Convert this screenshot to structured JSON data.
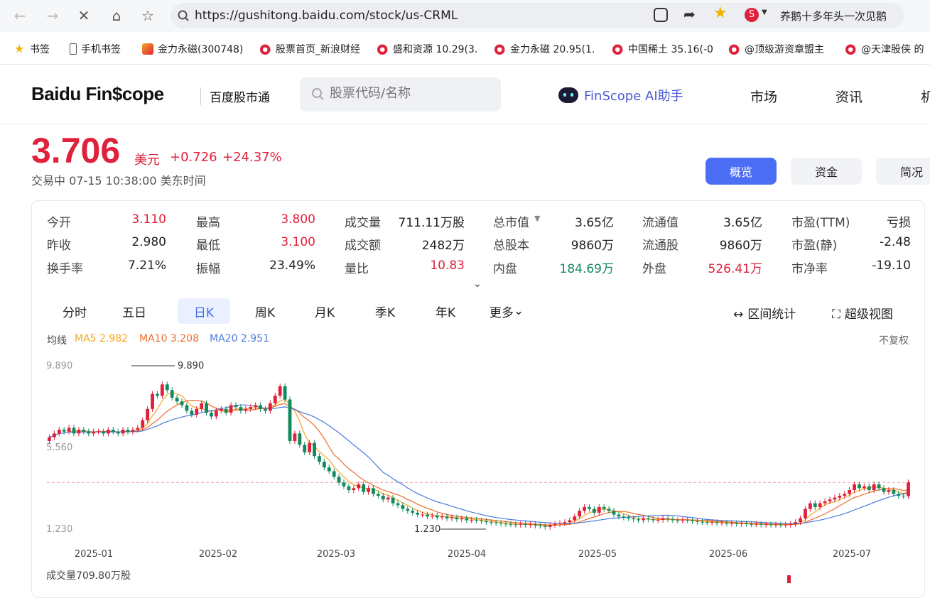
{
  "browser": {
    "url": "https://gushitong.baidu.com/stock/us-CRML",
    "tab_title": "养鹅十多年头一次见鹅"
  },
  "bookmarks": [
    {
      "label": "书签",
      "icon": "star-icon"
    },
    {
      "label": "手机书签",
      "icon": "phone-icon"
    },
    {
      "label": "金力永磁(300748)",
      "icon": "fund-icon"
    },
    {
      "label": "股票首页_新浪财经",
      "icon": "weibo-icon"
    },
    {
      "label": "盛和资源 10.29(3.",
      "icon": "weibo-icon"
    },
    {
      "label": "金力永磁 20.95(1.",
      "icon": "weibo-icon"
    },
    {
      "label": "中国稀土 35.16(-0",
      "icon": "weibo-icon"
    },
    {
      "label": "@顶级游资章盟主",
      "icon": "weibo-icon"
    },
    {
      "label": "@天津股侠 的",
      "icon": "weibo-icon"
    }
  ],
  "site": {
    "logo": "Baidu Fin$cope",
    "logo_sub": "百度股市通",
    "search_placeholder": "股票代码/名称",
    "ai_label": "FinScope AI助手",
    "nav": [
      "市场",
      "资讯",
      "机"
    ]
  },
  "quote": {
    "price": "3.706",
    "unit": "美元",
    "change": "+0.726",
    "change_pct": "+24.37%",
    "status": "交易中  07-15 10:38:00  美东时间"
  },
  "tabs": [
    "概览",
    "资金",
    "简况"
  ],
  "stats": [
    [
      {
        "label": "今开",
        "value": "3.110",
        "color": "red"
      },
      {
        "label": "最高",
        "value": "3.800",
        "color": "red"
      },
      {
        "label": "成交量",
        "value": "711.11万股",
        "color": ""
      },
      {
        "label": "总市值",
        "value": "3.65亿",
        "color": ""
      },
      {
        "label": "流通值",
        "value": "3.65亿",
        "color": ""
      },
      {
        "label": "市盈(TTM)",
        "value": "亏损",
        "color": ""
      }
    ],
    [
      {
        "label": "昨收",
        "value": "2.980",
        "color": ""
      },
      {
        "label": "最低",
        "value": "3.100",
        "color": "red"
      },
      {
        "label": "成交额",
        "value": "2482万",
        "color": ""
      },
      {
        "label": "总股本",
        "value": "9860万",
        "color": ""
      },
      {
        "label": "流通股",
        "value": "9860万",
        "color": ""
      },
      {
        "label": "市盈(静)",
        "value": "-2.48",
        "color": ""
      }
    ],
    [
      {
        "label": "换手率",
        "value": "7.21%",
        "color": ""
      },
      {
        "label": "振幅",
        "value": "23.49%",
        "color": ""
      },
      {
        "label": "量比",
        "value": "10.83",
        "color": "red"
      },
      {
        "label": "内盘",
        "value": "184.69万",
        "color": "green"
      },
      {
        "label": "外盘",
        "value": "526.41万",
        "color": "red"
      },
      {
        "label": "市净率",
        "value": "-19.10",
        "color": ""
      }
    ]
  ],
  "kline_tabs": [
    "分时",
    "五日",
    "日K",
    "周K",
    "月K",
    "季K",
    "年K",
    "更多"
  ],
  "kline_active": "日K",
  "tools": {
    "range_stats": "区间统计",
    "super_view": "超级视图"
  },
  "ma_legend": {
    "title": "均线",
    "ma5": "MA5 2.982",
    "ma10": "MA10 3.208",
    "ma20": "MA20 2.951",
    "adjust": "不复权"
  },
  "colors": {
    "up": "#e0213b",
    "down": "#138a5e",
    "ma5": "#f5a623",
    "ma10": "#f06a2a",
    "ma20": "#4a7be0",
    "accent": "#4c6ef5"
  },
  "chart_data": {
    "type": "candlestick",
    "y_ticks": [
      "9.890",
      "5.560",
      "1.230"
    ],
    "ylim": [
      1.23,
      9.89
    ],
    "x_ticks": [
      "2025-01",
      "2025-02",
      "2025-03",
      "2025-04",
      "2025-05",
      "2025-06",
      "2025-07"
    ],
    "annotations": {
      "high": "9.890",
      "low": "1.230"
    },
    "last_close": 3.706,
    "volume_label": "成交量709.80万股",
    "closes": [
      6.1,
      6.3,
      6.5,
      6.4,
      6.6,
      6.3,
      6.5,
      6.4,
      6.3,
      6.4,
      6.4,
      6.3,
      6.5,
      6.4,
      6.3,
      6.5,
      6.4,
      6.5,
      6.6,
      7.0,
      7.6,
      8.4,
      8.3,
      8.9,
      8.6,
      8.2,
      8.0,
      7.8,
      7.5,
      7.3,
      7.6,
      7.9,
      7.4,
      7.2,
      7.5,
      7.6,
      7.4,
      7.8,
      7.7,
      7.5,
      7.6,
      7.7,
      7.8,
      7.6,
      7.5,
      7.9,
      8.3,
      8.8,
      8.1,
      5.9,
      6.3,
      5.7,
      5.3,
      5.8,
      5.1,
      4.8,
      4.5,
      4.3,
      4.0,
      3.7,
      3.5,
      3.3,
      3.4,
      3.6,
      3.2,
      3.4,
      3.1,
      3.0,
      2.8,
      2.9,
      2.6,
      2.5,
      2.3,
      2.2,
      2.1,
      2.0,
      2.0,
      1.9,
      1.95,
      1.85,
      1.9,
      1.8,
      1.85,
      1.75,
      1.8,
      1.7,
      1.72,
      1.68,
      1.65,
      1.6,
      1.58,
      1.55,
      1.52,
      1.5,
      1.48,
      1.46,
      1.5,
      1.45,
      1.48,
      1.42,
      1.4,
      1.35,
      1.45,
      1.5,
      1.55,
      1.6,
      1.7,
      1.9,
      2.2,
      2.4,
      2.3,
      2.1,
      2.4,
      2.3,
      2.2,
      2.0,
      1.9,
      1.85,
      1.8,
      1.75,
      1.7,
      1.8,
      1.75,
      1.7,
      1.72,
      1.8,
      1.75,
      1.7,
      1.68,
      1.72,
      1.7,
      1.65,
      1.62,
      1.6,
      1.58,
      1.6,
      1.55,
      1.57,
      1.52,
      1.55,
      1.5,
      1.53,
      1.5,
      1.48,
      1.5,
      1.46,
      1.48,
      1.45,
      1.47,
      1.44,
      1.46,
      1.5,
      1.6,
      1.8,
      2.3,
      2.6,
      2.4,
      2.6,
      2.7,
      2.8,
      2.9,
      3.0,
      3.1,
      3.3,
      3.6,
      3.4,
      3.5,
      3.3,
      3.6,
      3.4,
      3.2,
      3.3,
      3.1,
      3.0,
      2.98,
      3.706
    ]
  }
}
